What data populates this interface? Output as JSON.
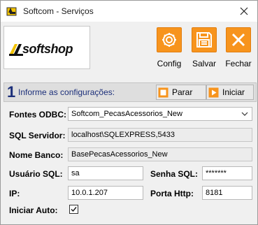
{
  "window": {
    "title": "Softcom - Serviços"
  },
  "logo": {
    "text": "softshop"
  },
  "toolbar": {
    "config_label": "Config",
    "save_label": "Salvar",
    "close_label": "Fechar",
    "accent_color": "#f7941d"
  },
  "section": {
    "number": "1",
    "title": "Informe as configurações:",
    "stop_label": "Parar",
    "start_label": "Iniciar"
  },
  "form": {
    "odbc_label": "Fontes ODBC:",
    "odbc_value": "Softcom_PecasAcessorios_New",
    "server_label": "SQL Servidor:",
    "server_value": "localhost\\SQLEXPRESS,5433",
    "db_label": "Nome Banco:",
    "db_value": "BasePecasAcessorios_New",
    "user_label": "Usuário SQL:",
    "user_value": "sa",
    "password_label": "Senha SQL:",
    "password_value": "*******",
    "ip_label": "IP:",
    "ip_value": "10.0.1.207",
    "port_label": "Porta Http:",
    "port_value": "8181",
    "autostart_label": "Iniciar Auto:",
    "autostart_checked": true
  }
}
